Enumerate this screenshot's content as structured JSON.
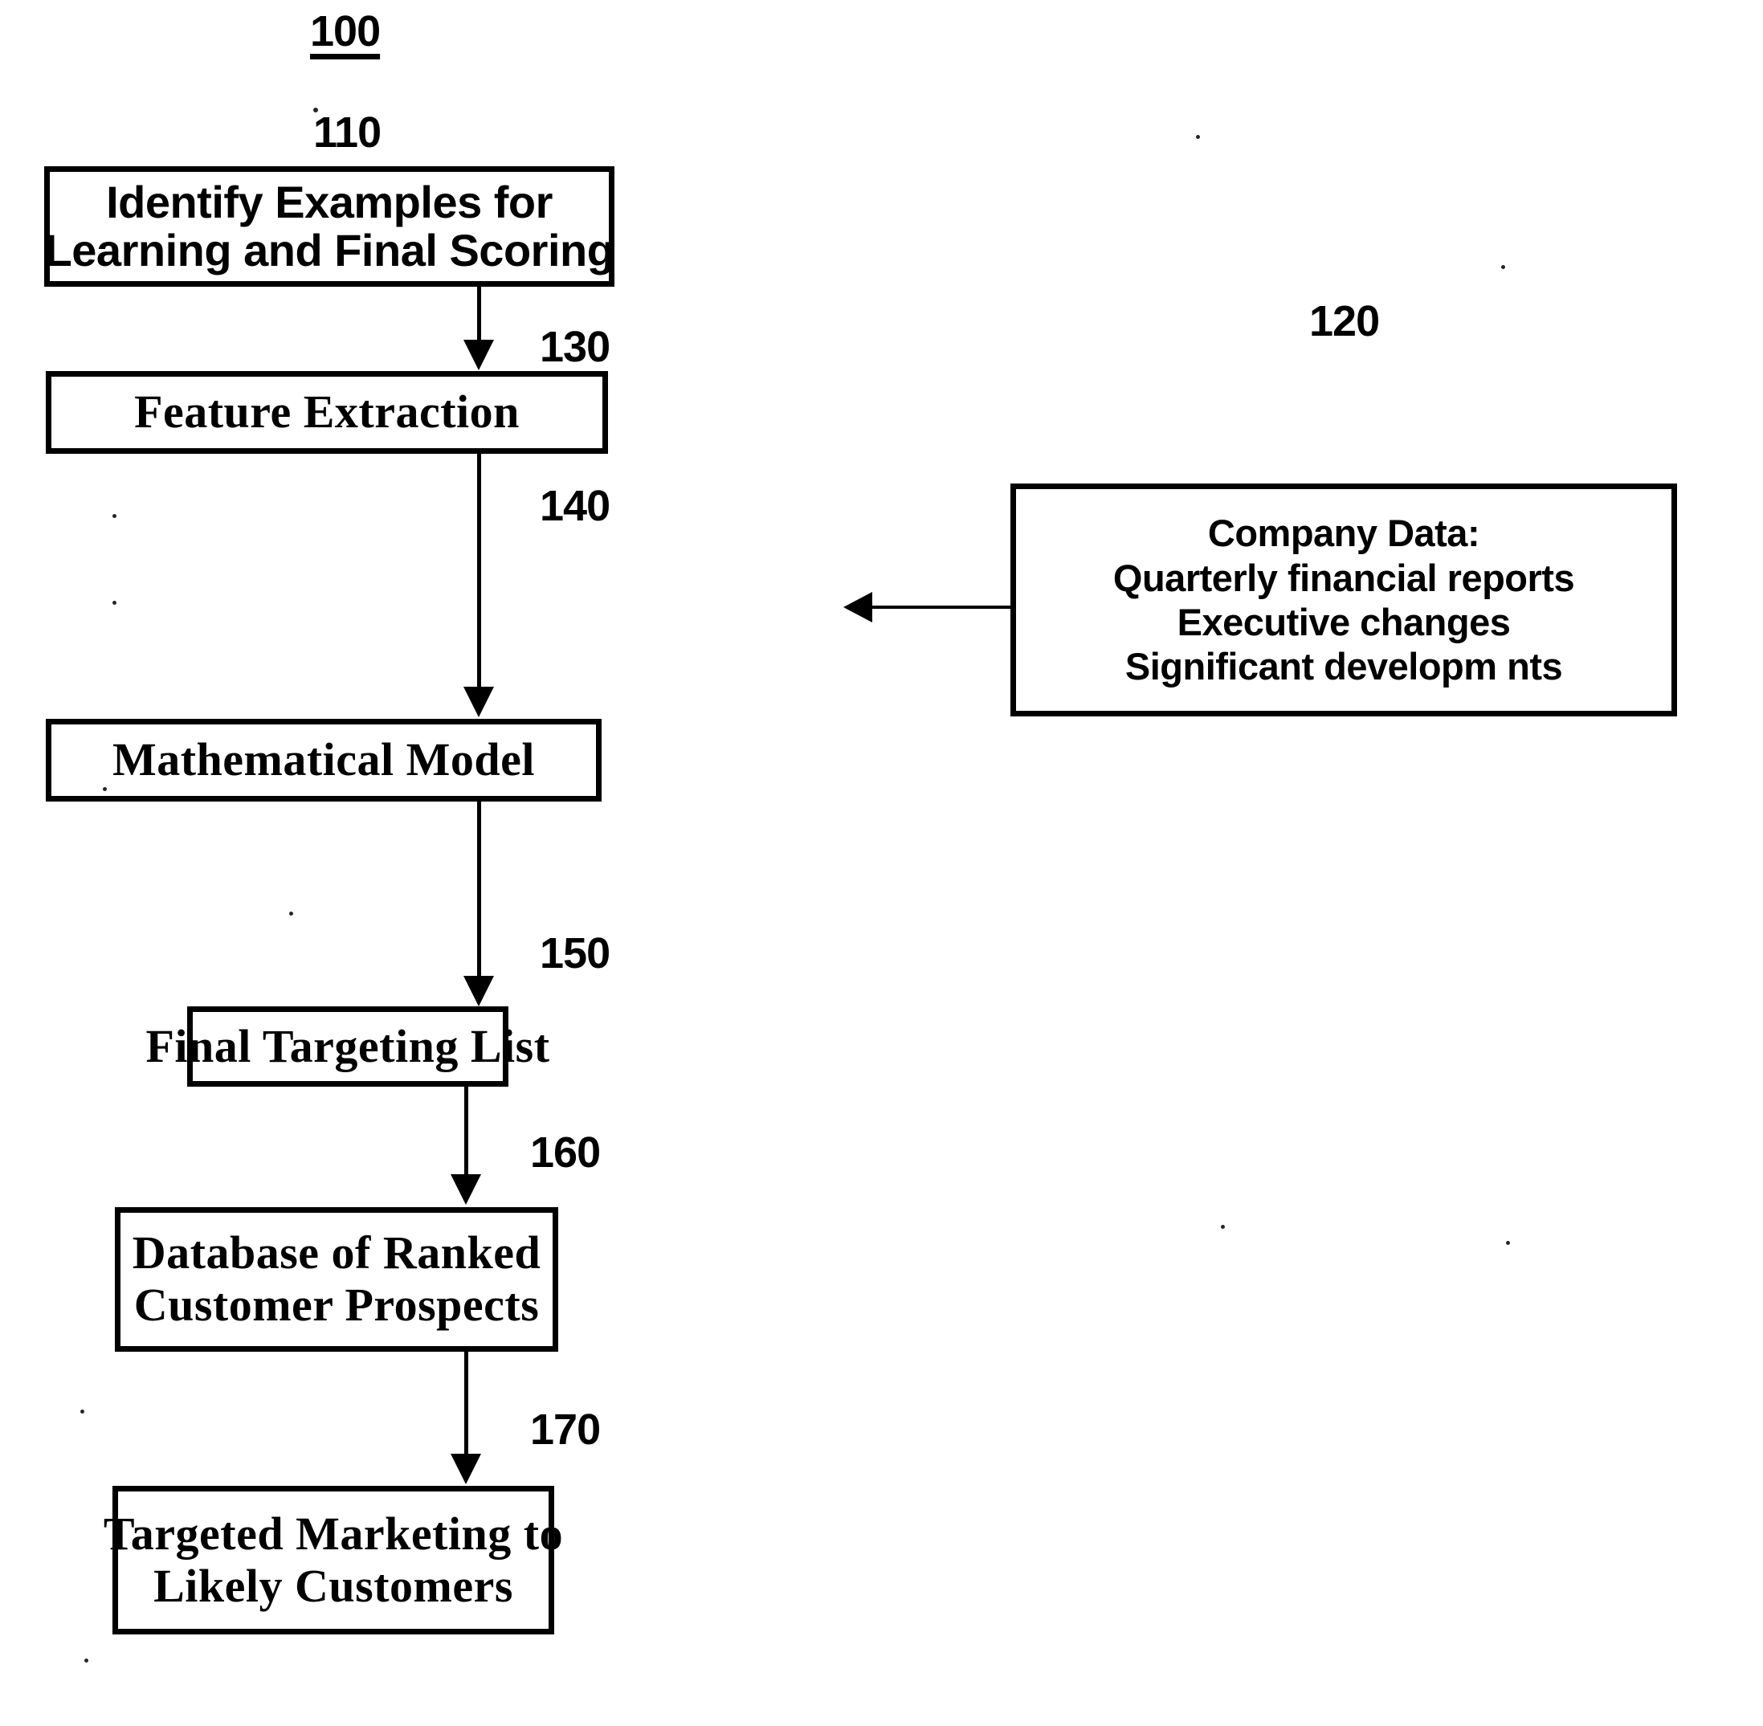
{
  "figure": {
    "number": "100",
    "type": "patent-flowchart"
  },
  "nodes": [
    {
      "ref": "110",
      "name": "identify-examples",
      "lines": [
        "Identify Examples for",
        "Learning and Final Scoring"
      ],
      "font": "sans"
    },
    {
      "ref": "130",
      "name": "feature-extraction",
      "lines": [
        "Feature Extraction"
      ],
      "font": "serif"
    },
    {
      "ref": "120",
      "name": "company-data",
      "lines": [
        "Company Data:",
        "Quarterly financial reports",
        "Executive changes",
        "Significant developm  nts"
      ],
      "font": "sans"
    },
    {
      "ref": "140",
      "name": "mathematical-model",
      "lines": [
        "Mathematical Model"
      ],
      "font": "serif"
    },
    {
      "ref": "150",
      "name": "final-targeting-list",
      "lines": [
        "Final Targeting List"
      ],
      "font": "serif"
    },
    {
      "ref": "160",
      "name": "database-ranked-prospects",
      "lines": [
        "Database of Ranked",
        "Customer Prospects"
      ],
      "font": "serif"
    },
    {
      "ref": "170",
      "name": "targeted-marketing",
      "lines": [
        "Targeted Marketing to",
        "Likely Customers"
      ],
      "font": "serif"
    }
  ],
  "colors": {
    "ink": "#000000",
    "paper": "#ffffff"
  }
}
